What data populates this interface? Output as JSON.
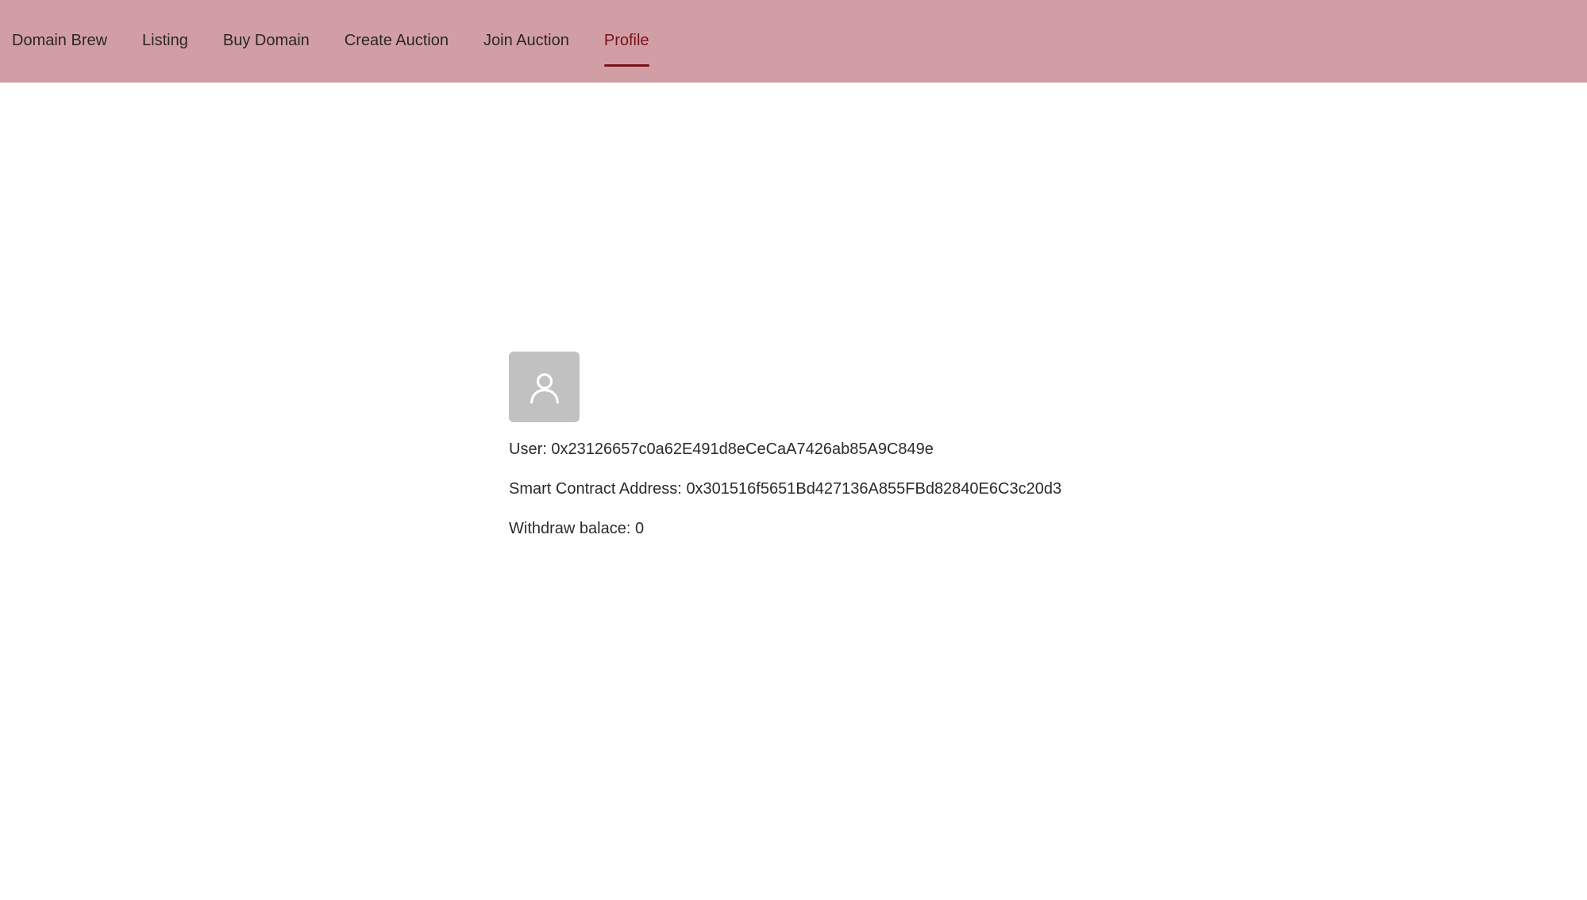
{
  "nav": {
    "items": [
      {
        "label": "Domain Brew"
      },
      {
        "label": "Listing"
      },
      {
        "label": "Buy Domain"
      },
      {
        "label": "Create Auction"
      },
      {
        "label": "Join Auction"
      },
      {
        "label": "Profile",
        "active": true
      }
    ]
  },
  "profile": {
    "avatar_icon": "user-icon",
    "user_label": "User:",
    "user_value": "0x23126657c0a62E491d8eCeCaA7426ab85A9C849e",
    "contract_label": "Smart Contract Address:",
    "contract_value": "0x301516f5651Bd427136A855FBd82840E6C3c20d3",
    "balance_label": "Withdraw balace:",
    "balance_value": "0"
  },
  "colors": {
    "topbar": "#d29ea6",
    "active_accent": "#7a1119",
    "avatar_bg": "#c1c1c1"
  }
}
